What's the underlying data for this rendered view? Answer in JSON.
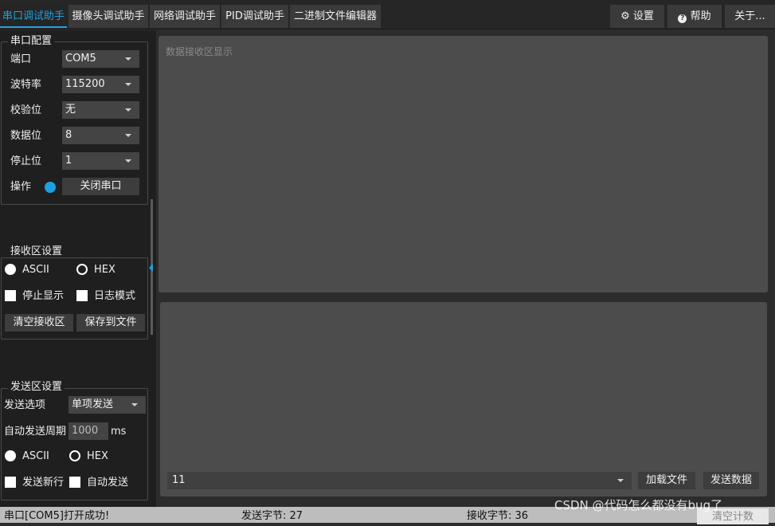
{
  "tabs": [
    "串口调试助手",
    "摄像头调试助手",
    "网络调试助手",
    "PID调试助手",
    "二进制文件编辑器"
  ],
  "toolbar": {
    "settings": "设置",
    "help": "帮助",
    "about": "关于..."
  },
  "serial_config": {
    "title": "串口配置",
    "port_label": "端口",
    "port_value": "COM5",
    "baud_label": "波特率",
    "baud_value": "115200",
    "parity_label": "校验位",
    "parity_value": "无",
    "databits_label": "数据位",
    "databits_value": "8",
    "stopbits_label": "停止位",
    "stopbits_value": "1",
    "op_label": "操作",
    "op_button": "关闭串口"
  },
  "receive_settings": {
    "title": "接收区设置",
    "ascii": "ASCII",
    "hex": "HEX",
    "stop_display": "停止显示",
    "log_mode": "日志模式",
    "clear_button": "清空接收区",
    "save_button": "保存到文件"
  },
  "send_settings": {
    "title": "发送区设置",
    "option_label": "发送选项",
    "option_value": "单项发送",
    "period_label": "自动发送周期",
    "period_value": "1000",
    "period_unit": "ms",
    "ascii": "ASCII",
    "hex": "HEX",
    "newline": "发送新行",
    "auto_send": "自动发送"
  },
  "receive_area": {
    "placeholder": "数据接收区显示"
  },
  "send_area": {
    "input_value": "11",
    "load_button": "加载文件",
    "send_button": "发送数据"
  },
  "status": {
    "message": "串口[COM5]打开成功!",
    "sent": "发送字节: 27",
    "received": "接收字节: 36",
    "clear_count": "清空计数"
  },
  "watermark": "CSDN @代码怎么都没有bug了",
  "colors": {
    "accent": "#1ea0e0",
    "panel": "#4c4c4c",
    "background": "#1f1f1f"
  }
}
